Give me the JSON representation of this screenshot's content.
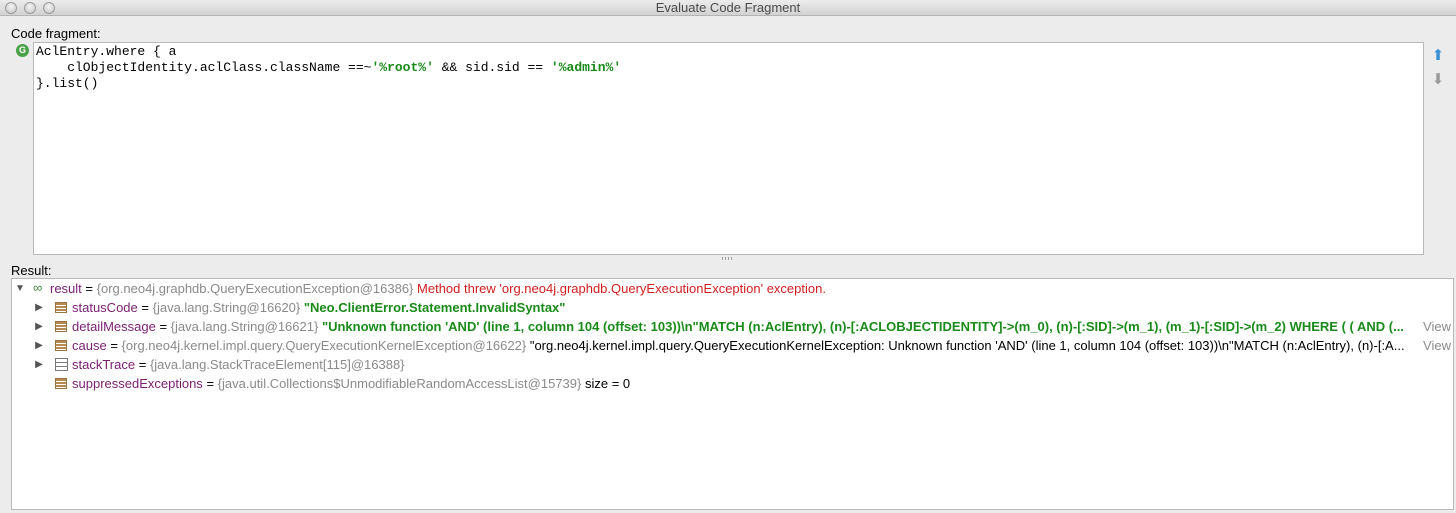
{
  "window": {
    "title": "Evaluate Code Fragment"
  },
  "code_fragment": {
    "label": "Code fragment:",
    "lines": [
      {
        "pre": "AclEntry.where { a",
        "s1": "",
        "mid": "",
        "s2": ""
      },
      {
        "pre": "    clObjectIdentity.aclClass.className ==~",
        "s1": "'%root%'",
        "mid": " && sid.sid == ",
        "s2": "'%admin%'"
      },
      {
        "pre": "}.list()",
        "s1": "",
        "mid": "",
        "s2": ""
      }
    ]
  },
  "result": {
    "label": "Result:",
    "root": {
      "name": "result",
      "type": "{org.neo4j.graphdb.QueryExecutionException@16386}",
      "message": "Method threw 'org.neo4j.graphdb.QueryExecutionException' exception."
    },
    "children": [
      {
        "name": "statusCode",
        "type": "{java.lang.String@16620}",
        "value": "\"Neo.ClientError.Statement.InvalidSyntax\"",
        "view": ""
      },
      {
        "name": "detailMessage",
        "type": "{java.lang.String@16621}",
        "value": "\"Unknown function 'AND' (line 1, column 104 (offset: 103))\\n\"MATCH (n:AclEntry), (n)-[:ACLOBJECTIDENTITY]->(m_0), (n)-[:SID]->(m_1), (m_1)-[:SID]->(m_2) WHERE ( (  AND (...",
        "view": "View"
      },
      {
        "name": "cause",
        "type": "{org.neo4j.kernel.impl.query.QueryExecutionKernelException@16622}",
        "value": "\"org.neo4j.kernel.impl.query.QueryExecutionKernelException: Unknown function 'AND' (line 1, column 104 (offset: 103))\\n\"MATCH (n:AclEntry), (n)-[:A...",
        "view": "View"
      },
      {
        "name": "stackTrace",
        "type": "{java.lang.StackTraceElement[115]@16388}",
        "value": "",
        "view": ""
      },
      {
        "name": "suppressedExceptions",
        "type": "{java.util.Collections$UnmodifiableRandomAccessList@15739}",
        "value": " size = 0",
        "view": ""
      }
    ]
  },
  "icons": {
    "expanded": "triangle-down",
    "collapsed": "triangle-right",
    "result": "watch-result-icon",
    "field": "field-icon",
    "array": "array-icon",
    "groovy": "groovy-g-icon",
    "history_up": "arrow-up-icon",
    "history_down": "arrow-down-icon"
  }
}
